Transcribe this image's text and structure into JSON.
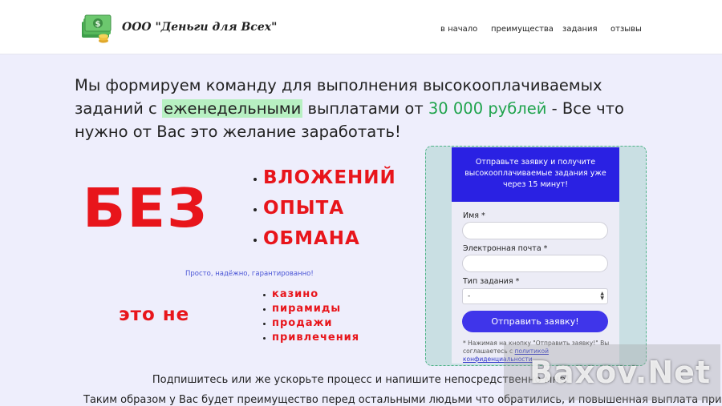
{
  "header": {
    "logo_text": "ООО \"Деньги для Всех\"",
    "nav": [
      {
        "label": "в начало"
      },
      {
        "label": "преимущества"
      },
      {
        "label": "задания"
      },
      {
        "label": "отзывы"
      }
    ]
  },
  "headline": {
    "part1": "Мы формируем команду для выполнения высокооплачиваемых заданий с ",
    "highlight": "еженедельными",
    "part2": " выплатами от ",
    "amount": "30 000 рублей",
    "part3": " - Все что нужно от Вас это желание заработать!"
  },
  "bez": {
    "title": "БЕЗ",
    "items": [
      "ВЛОЖЕНИЙ",
      "ОПЫТА",
      "ОБМАНА"
    ]
  },
  "tagline": "Просто, надёжно, гарантированно!",
  "eto_ne": {
    "title": "это не",
    "items": [
      "казино",
      "пирамиды",
      "продажи",
      "привлечения"
    ]
  },
  "form": {
    "header": "Отправьте заявку и получите высокооплачиваемые задания уже через 15 минут!",
    "name_label": "Имя *",
    "email_label": "Электронная почта *",
    "task_label": "Тип задания *",
    "task_value": "-",
    "submit_label": "Отправить заявку!",
    "note_text": "* Нажимая на кнопку \"Отправить заявку!\" Вы соглашаетесь с ",
    "note_link": "политикой конфиденциальности"
  },
  "bottom": {
    "line1": "Подпишитесь или же ускорьте процесс и напишите непосредственно мне!",
    "line2": "Таким образом  у Вас будет преимущество перед остальными людьми что обратились, и повышенная выплата при"
  },
  "watermark": "Baxov.Net",
  "colors": {
    "accent_blue": "#2a21e3",
    "red": "#e8151b",
    "green": "#1fa34c",
    "background": "#eeeefc"
  }
}
